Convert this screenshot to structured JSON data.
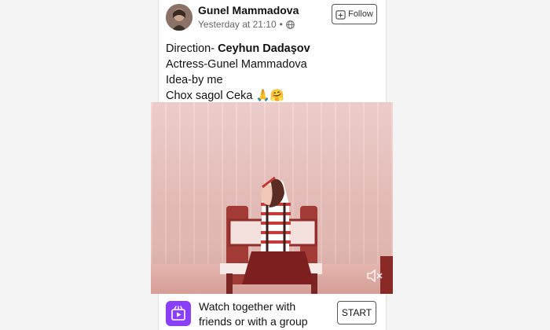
{
  "post": {
    "author": "Gunel Mammadova",
    "timestamp": "Yesterday at 21:10",
    "separator": "•",
    "privacy_icon": "globe-icon",
    "follow_label": "Follow",
    "caption": {
      "line1_prefix": "Direction- ",
      "line1_bold": "Ceyhun Dadaşov",
      "line2": "Actress-Gunel Mammadova",
      "line3": "Idea-by me",
      "line4_text": "Chox sagol Ceka",
      "line4_emoji": "🙏🤗"
    }
  },
  "video": {
    "mute_icon": "speaker-muted-icon"
  },
  "watch_together": {
    "icon": "watch-party-icon",
    "line1": "Watch together with",
    "line2": "friends or with a group",
    "start_label": "START"
  },
  "colors": {
    "accent": "#8a3ffc",
    "video_tint": "#f3d3d0"
  }
}
